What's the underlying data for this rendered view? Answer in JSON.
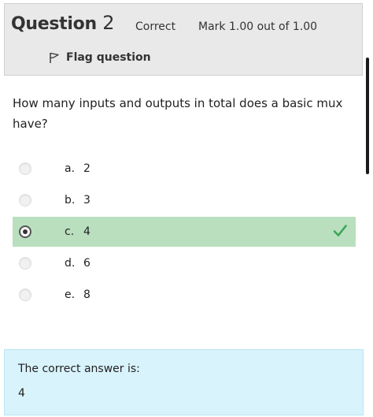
{
  "question": {
    "title_word": "Question",
    "number": "2",
    "state": "Correct",
    "grade": "Mark 1.00 out of 1.00",
    "flag_label": "Flag question",
    "flag_icon": "flag-icon",
    "text": "How many inputs and outputs in total does a basic mux have?"
  },
  "answers": [
    {
      "letter": "a.",
      "text": "2",
      "selected": false,
      "correct": false
    },
    {
      "letter": "b.",
      "text": "3",
      "selected": false,
      "correct": false
    },
    {
      "letter": "c.",
      "text": "4",
      "selected": true,
      "correct": true
    },
    {
      "letter": "d.",
      "text": "6",
      "selected": false,
      "correct": false
    },
    {
      "letter": "e.",
      "text": "8",
      "selected": false,
      "correct": false
    }
  ],
  "feedback": {
    "label": "The correct answer is:",
    "value": "4"
  },
  "colors": {
    "info_background": "#e9e9e9",
    "correct_highlight": "#b9dfbf",
    "check_mark": "#3aa757",
    "feedback_background": "#d8f3fc"
  }
}
